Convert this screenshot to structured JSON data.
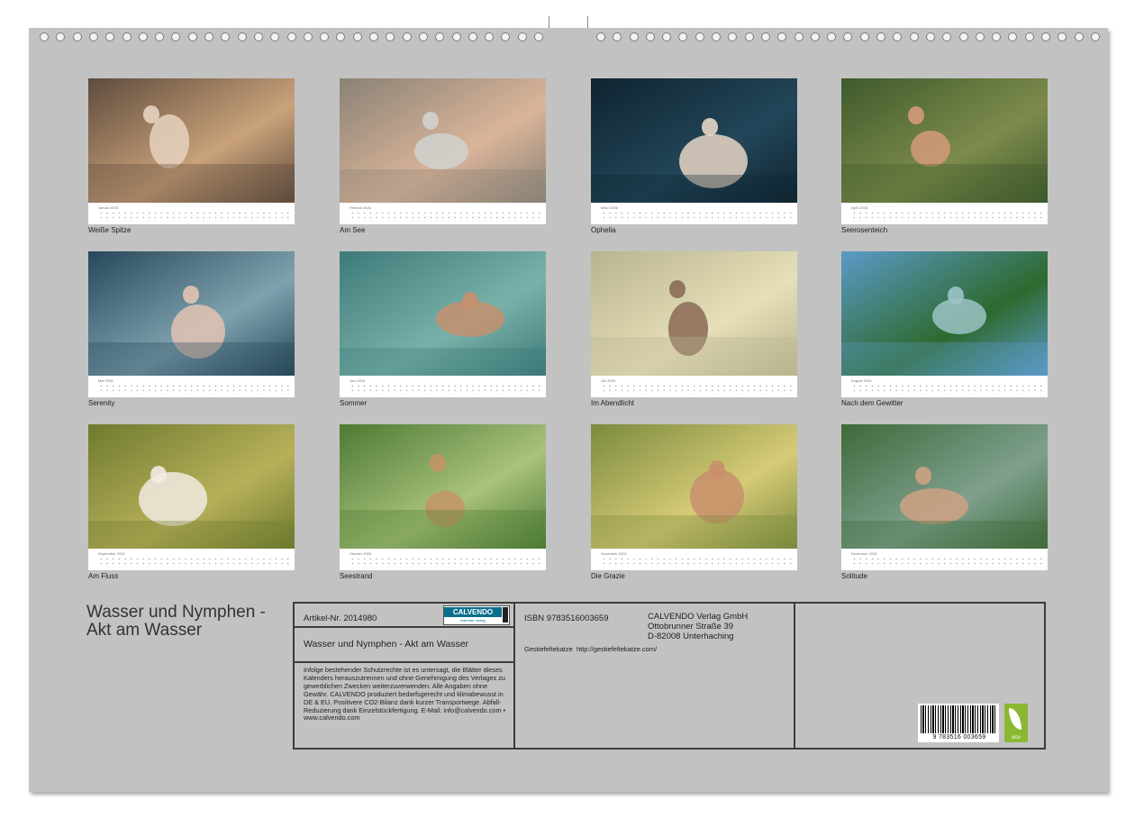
{
  "months": [
    {
      "label": "Januar 2026",
      "caption": "Weiße Spitze",
      "palette": [
        "#5e4b3d",
        "#c9a27a",
        "#e6d2bf"
      ]
    },
    {
      "label": "Februar 2026",
      "caption": "Am See",
      "palette": [
        "#8a8275",
        "#d9b49a",
        "#cfd2cf"
      ]
    },
    {
      "label": "März 2026",
      "caption": "Ophelia",
      "palette": [
        "#0f2430",
        "#23465a",
        "#e8d6c4"
      ]
    },
    {
      "label": "April 2026",
      "caption": "Seerosenteich",
      "palette": [
        "#3f5a2c",
        "#7d8b4c",
        "#d49a7a"
      ]
    },
    {
      "label": "Mai 2026",
      "caption": "Serenity",
      "palette": [
        "#27485a",
        "#7fa2b0",
        "#e3c3b3"
      ]
    },
    {
      "label": "Juni 2026",
      "caption": "Sommer",
      "palette": [
        "#3d7a78",
        "#79b1aa",
        "#c6906e"
      ]
    },
    {
      "label": "Juli 2026",
      "caption": "Im Abendlicht",
      "palette": [
        "#b8b48f",
        "#e6dfb8",
        "#8a6a56"
      ]
    },
    {
      "label": "August 2026",
      "caption": "Nach dem Gewitter",
      "palette": [
        "#5b9ac8",
        "#2d6a2f",
        "#9cc4c6"
      ]
    },
    {
      "label": "September 2026",
      "caption": "Am Fluss",
      "palette": [
        "#6f7a2e",
        "#b7b05a",
        "#f1ebe2"
      ]
    },
    {
      "label": "Oktober 2026",
      "caption": "Seestrand",
      "palette": [
        "#4d7a32",
        "#a9c27d",
        "#c39468"
      ]
    },
    {
      "label": "November 2026",
      "caption": "Die Grazie",
      "palette": [
        "#7b8a3d",
        "#d6cb77",
        "#c98f6c"
      ]
    },
    {
      "label": "Dezember 2026",
      "caption": "Solitude",
      "palette": [
        "#3f6a3a",
        "#7fa08e",
        "#cfa183"
      ]
    }
  ],
  "title_line1": "Wasser und Nymphen -",
  "title_line2": "Akt am Wasser",
  "article_no": "Artikel-Nr. 2014980",
  "logo_text": "CALVENDO",
  "logo_sub": "kalender verlag",
  "product_title": "Wasser und Nymphen - Akt am Wasser",
  "legal_text": "Infolge bestehender Schutzrechte ist es untersagt, die Blätter dieses Kalenders herauszutrennen und ohne Genehmigung des Verlages zu gewerblichen Zwecken weiterzuverwenden. Alle Angaben ohne Gewähr. CALVENDO produziert bedarfsgerecht und klimabewusst in DE & EU. Positivere CO2-Bilanz dank kurzer Transportwege. Abfall-Reduzierung dank Einzelstückfertigung. E-Mail: info@calvendo.com • www.calvendo.com",
  "isbn": "ISBN 9783516003659",
  "publisher_name": "CALVENDO Verlag GmbH",
  "publisher_street": "Ottobrunner Straße 39",
  "publisher_city": "D-82008 Unterhaching",
  "author": "Gestiefeltekatze",
  "author_url": "http://gestiefeltekatze.com/",
  "barcode_number": "9 783516 003659",
  "eco_label": "eco"
}
